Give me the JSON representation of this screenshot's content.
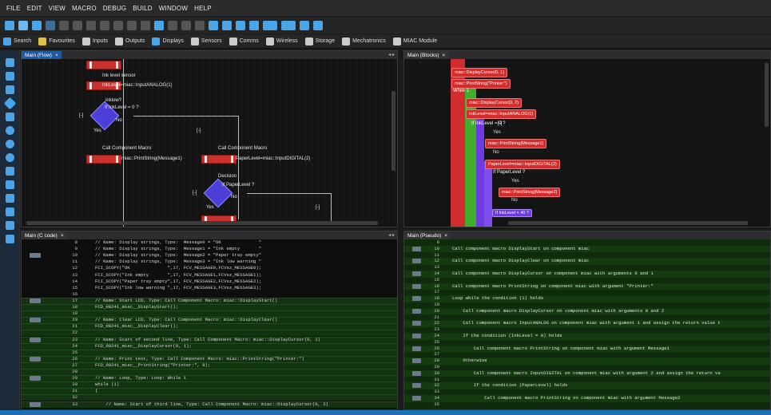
{
  "menu": [
    "FILE",
    "EDIT",
    "VIEW",
    "MACRO",
    "DEBUG",
    "BUILD",
    "WINDOW",
    "HELP"
  ],
  "toolbar2": [
    {
      "icon": "search-icon",
      "label": "Search",
      "color": "#4aa6e8"
    },
    {
      "icon": "star-icon",
      "label": "Favourites",
      "color": "#e0c040"
    },
    {
      "icon": "inputs-icon",
      "label": "Inputs",
      "color": "#ccc"
    },
    {
      "icon": "outputs-icon",
      "label": "Outputs",
      "color": "#ccc"
    },
    {
      "icon": "displays-icon",
      "label": "Displays",
      "color": "#4aa6e8"
    },
    {
      "icon": "sensors-icon",
      "label": "Sensors",
      "color": "#ccc"
    },
    {
      "icon": "comms-icon",
      "label": "Comms",
      "color": "#ccc"
    },
    {
      "icon": "wireless-icon",
      "label": "Wireless",
      "color": "#ccc"
    },
    {
      "icon": "storage-icon",
      "label": "Storage",
      "color": "#ccc"
    },
    {
      "icon": "mechatronics-icon",
      "label": "Mechatronics",
      "color": "#ccc"
    },
    {
      "icon": "miac-icon",
      "label": "MIAC Module",
      "color": "#ccc"
    }
  ],
  "panels": {
    "flow": {
      "tab": "Main (Flow)",
      "close": "×",
      "ctrl": "◂ ▸"
    },
    "blocks": {
      "tab": "Main (Blocks)",
      "close": "×"
    },
    "ccode": {
      "tab": "Main (C code)",
      "close": "×",
      "ctrl": "◂ ▸"
    },
    "pseudo": {
      "tab": "Main (Pseudo)",
      "close": "×"
    }
  },
  "flow": {
    "ink_sensor_title": "Ink level sensor",
    "ink_sensor_expr": "InkLevel=miac::InputANALOG(1)",
    "inklow_title": "inklow?",
    "inklow_expr": "If InkLevel = 0 ?",
    "yes1": "Yes",
    "no1": "No",
    "collapse1": "[-]",
    "collapse2": "[-]",
    "call1_title": "Call Component Macro",
    "call1_expr": "miac::PrintString(Message1)",
    "call2_title": "Call Component Macro",
    "call2_expr": "PaperLevel=miac::InputDIGITAL(2)",
    "decision_title": "Decision",
    "decision_expr": "If PaperLevel ?",
    "yes2": "Yes",
    "no2": "No",
    "collapse3": "[-]",
    "collapse4": "[-]"
  },
  "blocks": {
    "b1": "miac::DisplayCursor(0, 1)",
    "b2": "miac::PrintString(\"Printer:\")",
    "while": "While 1",
    "b3": "miac::DisplayCursor(0, 2)",
    "b4": "InkLevel=miac::InputANALOG(1)",
    "if1": "If InkLevel = 0 ?",
    "yes1": "Yes",
    "b5": "miac::PrintString(Message1)",
    "no1": "No",
    "b6": "PaperLevel=miac::InputDIGITAL(2)",
    "if2": "If PaperLevel ?",
    "yes2": "Yes",
    "b7": "miac::PrintString(Message2)",
    "no2": "No",
    "if3": "If InkLevel < 40 ?",
    "tog": "[-]"
  },
  "ccode": [
    {
      "n": "8",
      "t": "// Name: Display strings, Type:  Message0 = \"OK              \"",
      "g": false,
      "band": "dark"
    },
    {
      "n": "9",
      "t": "// Name: Display strings, Type:  Message1 = \"Ink empty       \"",
      "g": false,
      "band": "dark"
    },
    {
      "n": "10",
      "t": "// Name: Display strings, Type:  Message2 = \"Paper tray empty\"",
      "g": true,
      "band": "dark"
    },
    {
      "n": "11",
      "t": "// Name: Display strings, Type:  Message3 = \"Ink low warning \"",
      "g": false,
      "band": "dark"
    },
    {
      "n": "12",
      "t": "FCI_SCOPY(\"OK              \",17, FCV_MESSAGE0,FCVsz_MESSAGE0);",
      "g": false,
      "band": "dark"
    },
    {
      "n": "13",
      "t": "FCI_SCOPY(\"Ink empty       \",17, FCV_MESSAGE1,FCVsz_MESSAGE1);",
      "g": false,
      "band": "dark"
    },
    {
      "n": "14",
      "t": "FCI_SCOPY(\"Paper tray empty\",17, FCV_MESSAGE2,FCVsz_MESSAGE2);",
      "g": false,
      "band": "dark"
    },
    {
      "n": "15",
      "t": "FCI_SCOPY(\"Ink low warning \",17, FCV_MESSAGE3,FCVsz_MESSAGE3);",
      "g": false,
      "band": "dark"
    },
    {
      "n": "16",
      "t": "",
      "g": false,
      "band": "dark"
    },
    {
      "n": "17",
      "t": "// Name: Start LCD, Type: Call Component Macro: miac::DisplayStart()",
      "g": true,
      "band": "green"
    },
    {
      "n": "18",
      "t": "FCD_08241_miac__DisplayStart();",
      "g": false,
      "band": "green"
    },
    {
      "n": "19",
      "t": "",
      "g": false,
      "band": "green"
    },
    {
      "n": "20",
      "t": "// Name: Clear LCD, Type: Call Component Macro: miac::DisplayClear()",
      "g": true,
      "band": "green"
    },
    {
      "n": "21",
      "t": "FCD_08241_miac__DisplayClear();",
      "g": false,
      "band": "green"
    },
    {
      "n": "22",
      "t": "",
      "g": false,
      "band": "green"
    },
    {
      "n": "23",
      "t": "// Name: Start of second line, Type: Call Component Macro: miac::DisplayCursor(0, 1)",
      "g": true,
      "band": "green"
    },
    {
      "n": "24",
      "t": "FCD_08241_miac__DisplayCursor(0, 1);",
      "g": false,
      "band": "green"
    },
    {
      "n": "25",
      "t": "",
      "g": false,
      "band": "green"
    },
    {
      "n": "26",
      "t": "// Name: Print text, Type: Call Component Macro: miac::PrintString(\"Printer:\")",
      "g": true,
      "band": "green"
    },
    {
      "n": "27",
      "t": "FCD_08241_miac__PrintString(\"Printer:\", 9);",
      "g": false,
      "band": "green"
    },
    {
      "n": "28",
      "t": "",
      "g": false,
      "band": "green"
    },
    {
      "n": "29",
      "t": "// Name: Loop, Type: Loop: While 1",
      "g": true,
      "band": "green"
    },
    {
      "n": "30",
      "t": "while (1)",
      "g": false,
      "band": "green"
    },
    {
      "n": "31",
      "t": "{",
      "g": false,
      "band": "green"
    },
    {
      "n": "32",
      "t": "",
      "g": false,
      "band": "green"
    },
    {
      "n": "33",
      "t": "    // Name: Start of third line, Type: Call Component Macro: miac::DisplayCursor(0, 2)",
      "g": true,
      "band": "green"
    }
  ],
  "pseudo": [
    {
      "n": "9",
      "t": "",
      "g": false
    },
    {
      "n": "10",
      "t": "Call component macro DisplayStart on component miac",
      "g": true
    },
    {
      "n": "11",
      "t": "",
      "g": false
    },
    {
      "n": "12",
      "t": "Call component macro DisplayClear on component miac",
      "g": true
    },
    {
      "n": "13",
      "t": "",
      "g": false
    },
    {
      "n": "14",
      "t": "Call component macro DisplayCursor on component miac with arguments 0 and 1",
      "g": true
    },
    {
      "n": "15",
      "t": "",
      "g": false
    },
    {
      "n": "16",
      "t": "Call component macro PrintString on component miac with argument \"Printer:\"",
      "g": true
    },
    {
      "n": "17",
      "t": "",
      "g": false
    },
    {
      "n": "18",
      "t": "Loop while the condition (1) holds",
      "g": true
    },
    {
      "n": "19",
      "t": "",
      "g": false
    },
    {
      "n": "20",
      "t": "    Call component macro DisplayCursor on component miac with arguments 0 and 2",
      "g": true
    },
    {
      "n": "21",
      "t": "",
      "g": false
    },
    {
      "n": "22",
      "t": "    Call component macro InputANALOG on component miac with argument 1 and assign the return value t",
      "g": true
    },
    {
      "n": "23",
      "t": "",
      "g": false
    },
    {
      "n": "24",
      "t": "    If the condition (InkLevel = 0) holds",
      "g": true
    },
    {
      "n": "25",
      "t": "",
      "g": false
    },
    {
      "n": "26",
      "t": "        Call component macro PrintString on component miac with argument Message1",
      "g": true
    },
    {
      "n": "27",
      "t": "",
      "g": false
    },
    {
      "n": "28",
      "t": "    Otherwise",
      "g": true
    },
    {
      "n": "29",
      "t": "",
      "g": false
    },
    {
      "n": "30",
      "t": "        Call component macro InputDIGITAL on component miac with argument 2 and assign the return va",
      "g": true
    },
    {
      "n": "31",
      "t": "",
      "g": false
    },
    {
      "n": "32",
      "t": "        If the condition (PaperLevel) holds",
      "g": true
    },
    {
      "n": "33",
      "t": "",
      "g": false
    },
    {
      "n": "34",
      "t": "            Call component macro PrintString on component miac with argument Message2",
      "g": true
    },
    {
      "n": "35",
      "t": "",
      "g": false
    }
  ]
}
